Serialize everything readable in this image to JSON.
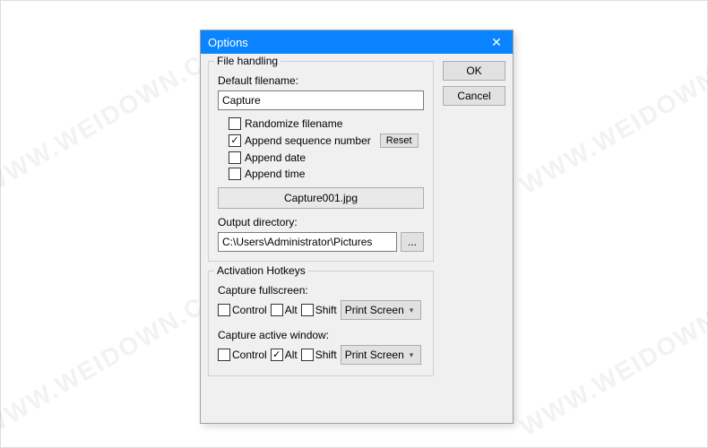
{
  "dialog": {
    "title": "Options",
    "ok_label": "OK",
    "cancel_label": "Cancel"
  },
  "file_handling": {
    "group_title": "File handling",
    "default_filename_label": "Default filename:",
    "default_filename_value": "Capture",
    "chk_randomize_label": "Randomize filename",
    "chk_append_seq_label": "Append sequence number",
    "reset_label": "Reset",
    "chk_append_date_label": "Append date",
    "chk_append_time_label": "Append time",
    "preview": "Capture001.jpg",
    "output_dir_label": "Output directory:",
    "output_dir_value": "C:\\Users\\Administrator\\Pictures",
    "browse_label": "..."
  },
  "hotkeys": {
    "group_title": "Activation Hotkeys",
    "fullscreen_label": "Capture fullscreen:",
    "active_window_label": "Capture active window:",
    "control_label": "Control",
    "alt_label": "Alt",
    "shift_label": "Shift",
    "key_print_screen": "Print Screen"
  },
  "watermark_text": "WWW.WEIDOWN.COM"
}
